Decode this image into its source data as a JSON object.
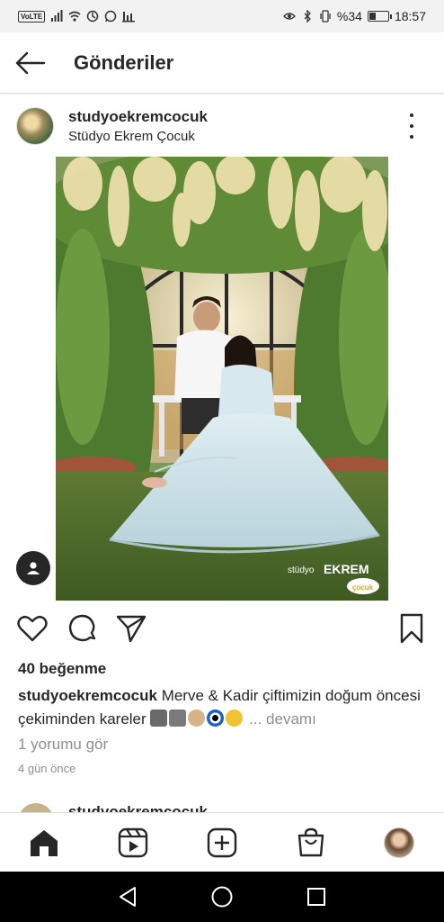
{
  "status_bar": {
    "volte": "VoLTE",
    "battery_text": "%34",
    "battery_level": 0.34,
    "time": "18:57"
  },
  "header": {
    "back_icon": "arrow-left-icon",
    "title": "Gönderiler"
  },
  "post": {
    "username": "studyoekremcocuk",
    "location": "Stüdyo Ekrem Çocuk",
    "likes": "40 beğenme",
    "caption_user": "studyoekremcocuk",
    "caption_text": "Merve & Kadir çiftimizin doğum öncesi çekiminden kareler",
    "caption_more": "... devamı",
    "view_comments": "1 yorumu gör",
    "time_ago": "4 gün önce",
    "watermark": "stüdyo ekrem çocuk"
  },
  "next_post": {
    "username": "studyoekremcocuk"
  },
  "bottom_nav": {
    "items": [
      "home-icon",
      "reels-icon",
      "new-post-icon",
      "shop-icon",
      "profile-avatar"
    ]
  },
  "colors": {
    "text": "#262626",
    "muted": "#8e8e8e",
    "divider": "#dbdbdb"
  }
}
